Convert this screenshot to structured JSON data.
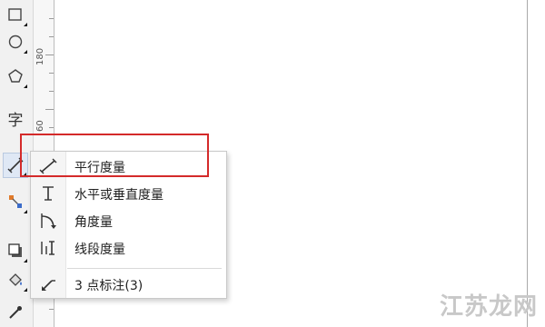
{
  "ruler": {
    "labels": [
      "180",
      "60"
    ]
  },
  "toolbox": {
    "text_tool_label": "字"
  },
  "flyout": {
    "items": [
      {
        "icon": "parallel-dimension-icon",
        "label": "平行度量"
      },
      {
        "icon": "horizontal-vertical-dimension-icon",
        "label": "水平或垂直度量"
      },
      {
        "icon": "angular-dimension-icon",
        "label": "角度量"
      },
      {
        "icon": "segment-dimension-icon",
        "label": "线段度量"
      },
      {
        "icon": "three-point-callout-icon",
        "label": "3 点标注(3)"
      }
    ]
  },
  "watermark": {
    "text": "江苏龙网"
  },
  "colors": {
    "highlight": "#d42a2a",
    "toolbox_bg": "#f1f1f1"
  }
}
